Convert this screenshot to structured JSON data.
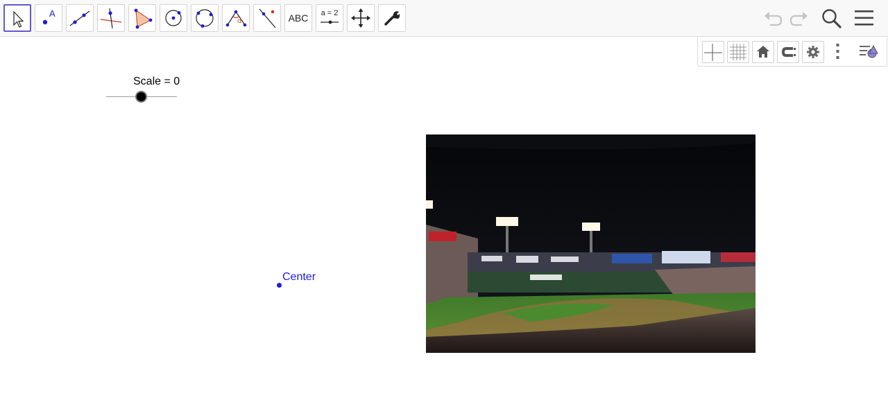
{
  "toolbar": {
    "tools": [
      {
        "name": "move-tool",
        "icon": "arrow-cursor-icon"
      },
      {
        "name": "point-tool",
        "icon": "point-icon",
        "label": "A"
      },
      {
        "name": "line-tool",
        "icon": "line-through-points-icon"
      },
      {
        "name": "perpendicular-line-tool",
        "icon": "perpendicular-line-icon"
      },
      {
        "name": "polygon-tool",
        "icon": "polygon-icon"
      },
      {
        "name": "circle-center-point-tool",
        "icon": "circle-center-point-icon"
      },
      {
        "name": "circle-three-points-tool",
        "icon": "circle-three-points-icon"
      },
      {
        "name": "angle-tool",
        "icon": "angle-icon",
        "label": "α"
      },
      {
        "name": "reflect-tool",
        "icon": "reflect-about-line-icon"
      },
      {
        "name": "text-tool",
        "label": "ABC"
      },
      {
        "name": "slider-tool",
        "label": "a = 2"
      },
      {
        "name": "move-graphics-view-tool",
        "icon": "move-arrows-icon"
      },
      {
        "name": "tools-settings",
        "icon": "wrench-icon"
      }
    ],
    "selected_tool": "move-tool",
    "right": [
      "undo-icon",
      "redo-icon",
      "search-icon",
      "menu-icon"
    ]
  },
  "style_bar": {
    "buttons": [
      "axes-icon",
      "grid-icon",
      "home-icon",
      "point-capturing-icon",
      "gear-icon",
      "more-vertical-icon",
      "style-bar-toggle-icon"
    ]
  },
  "graphics": {
    "slider": {
      "caption": "Scale = 0",
      "value": 0
    },
    "point": {
      "label": "Center"
    },
    "image": {
      "subject": "baseball stadium at night"
    }
  },
  "colors": {
    "accent": "#6557d2",
    "point": "#1d1ddb",
    "toolbar_bg": "#f8f8f8"
  }
}
